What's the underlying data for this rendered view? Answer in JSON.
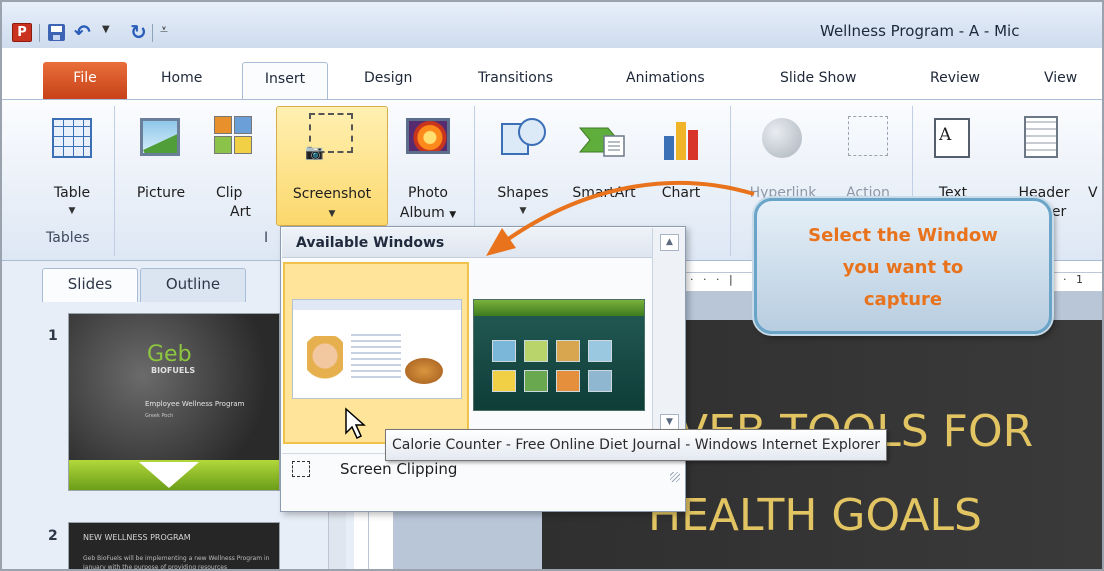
{
  "window": {
    "title": "Wellness Program - A - Mic"
  },
  "quick_access": {
    "app_glyph": "P",
    "icons": [
      "powerpoint-icon",
      "save-icon",
      "undo-icon",
      "redo-icon",
      "customize-icon"
    ]
  },
  "tabs": [
    {
      "label": "File"
    },
    {
      "label": "Home"
    },
    {
      "label": "Insert"
    },
    {
      "label": "Design"
    },
    {
      "label": "Transitions"
    },
    {
      "label": "Animations"
    },
    {
      "label": "Slide Show"
    },
    {
      "label": "Review"
    },
    {
      "label": "View"
    }
  ],
  "ribbon": {
    "groups": {
      "tables": "Tables",
      "images_partial": "I"
    },
    "buttons": {
      "table": "Table",
      "picture": "Picture",
      "clip_line1": "Clip",
      "clip_line2": "Art",
      "screenshot": "Screenshot",
      "photo_line1": "Photo",
      "photo_line2": "Album",
      "shapes": "Shapes",
      "smartart": "SmartArt",
      "chart": "Chart",
      "hyperlink": "Hyperlink",
      "action": "Action",
      "text_line1": "Text",
      "header_line1": "Header",
      "header_line2": "Footer",
      "partial_letter": "V",
      "text_icon_glyph": "A"
    }
  },
  "screenshot_menu": {
    "title": "Available Windows",
    "clipping_label": "Screen Clipping",
    "tooltip": "Calorie Counter - Free Online Diet Journal - Windows Internet Explorer"
  },
  "slides_pane": {
    "tabs": [
      "Slides",
      "Outline"
    ],
    "slides": [
      {
        "number": "1",
        "logo_top": "Geb",
        "logo_bottom": "BIOFUELS",
        "subtitle": "Employee Wellness Program",
        "byline": "Greek Poch"
      },
      {
        "number": "2",
        "title": "NEW WELLNESS PROGRAM",
        "body": "Geb BioFuels will be implementing a new Wellness Program in January with the purpose of providing resources"
      }
    ]
  },
  "ruler": {
    "left_marks": "· · · |",
    "right_marks": "· · 1"
  },
  "main_slide": {
    "line1": "VEB TOOLS FOR",
    "line2": "HEALTH GOALS"
  },
  "callout": {
    "line1": "Select the Window",
    "line2": "you  want to",
    "line3": "capture",
    "border_color": "#6aa4c8",
    "text_color": "#e8731c"
  },
  "colors": {
    "file_tab": "#d2521f",
    "highlight": "#fcd86c",
    "slide_title": "#e2c562"
  }
}
